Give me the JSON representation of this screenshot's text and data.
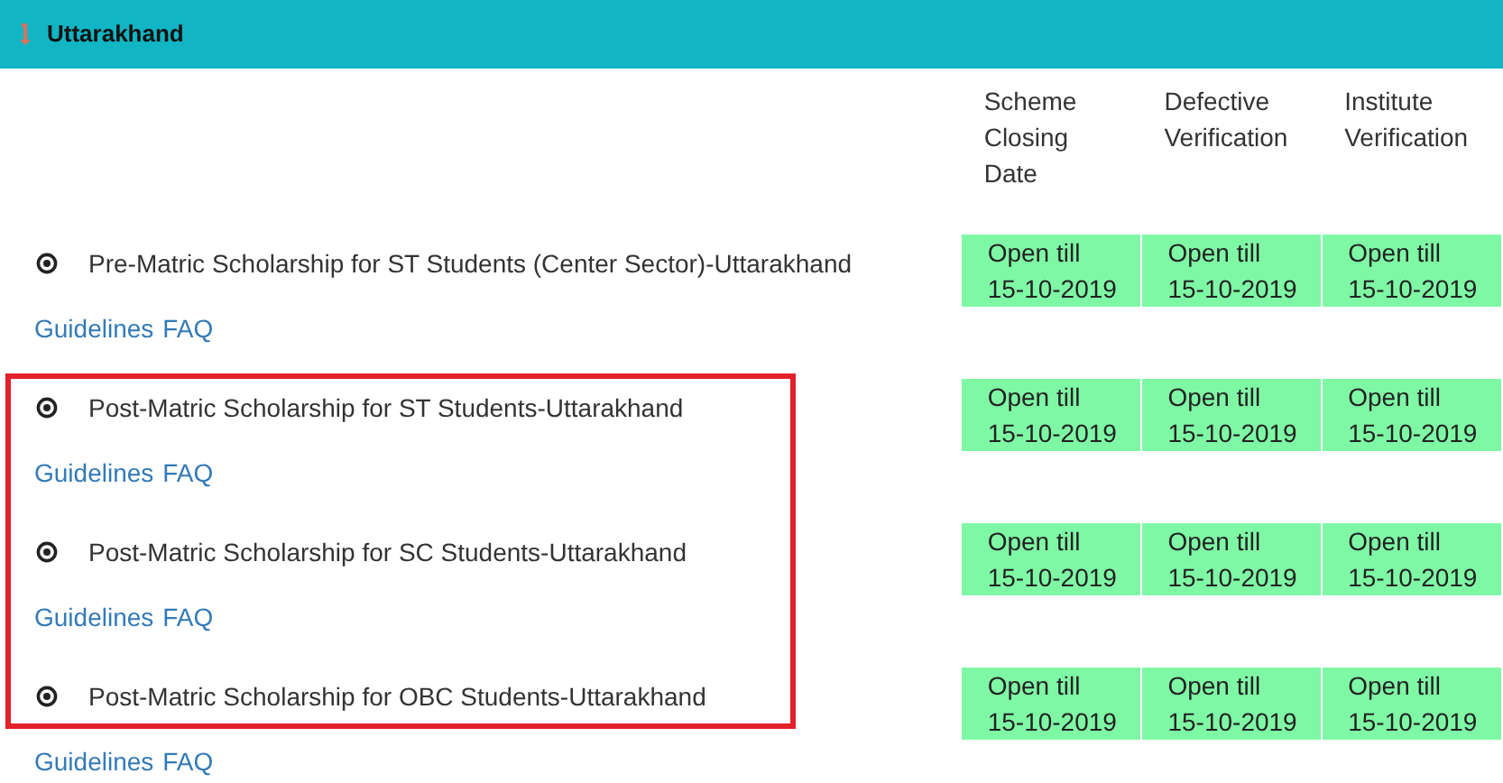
{
  "header": {
    "title": "Uttarakhand"
  },
  "columns": [
    "Scheme Closing Date",
    "Defective Verification",
    "Institute Verification"
  ],
  "schemes": [
    {
      "name": "Pre-Matric Scholarship for ST Students (Center Sector)-Uttarakhand",
      "highlighted": false,
      "statuses": [
        {
          "label": "Open till",
          "date": "15-10-2019"
        },
        {
          "label": "Open till",
          "date": "15-10-2019"
        },
        {
          "label": "Open till",
          "date": "15-10-2019"
        }
      ],
      "links": [
        "Guidelines",
        "FAQ"
      ]
    },
    {
      "name": "Post-Matric Scholarship for ST Students-Uttarakhand",
      "highlighted": true,
      "statuses": [
        {
          "label": "Open till",
          "date": "15-10-2019"
        },
        {
          "label": "Open till",
          "date": "15-10-2019"
        },
        {
          "label": "Open till",
          "date": "15-10-2019"
        }
      ],
      "links": [
        "Guidelines",
        "FAQ"
      ]
    },
    {
      "name": "Post-Matric Scholarship for SC Students-Uttarakhand",
      "highlighted": true,
      "statuses": [
        {
          "label": "Open till",
          "date": "15-10-2019"
        },
        {
          "label": "Open till",
          "date": "15-10-2019"
        },
        {
          "label": "Open till",
          "date": "15-10-2019"
        }
      ],
      "links": [
        "Guidelines",
        "FAQ"
      ]
    },
    {
      "name": "Post-Matric Scholarship for OBC Students-Uttarakhand",
      "highlighted": true,
      "statuses": [
        {
          "label": "Open till",
          "date": "15-10-2019"
        },
        {
          "label": "Open till",
          "date": "15-10-2019"
        },
        {
          "label": "Open till",
          "date": "15-10-2019"
        }
      ],
      "links": [
        "Guidelines",
        "FAQ"
      ]
    }
  ]
}
